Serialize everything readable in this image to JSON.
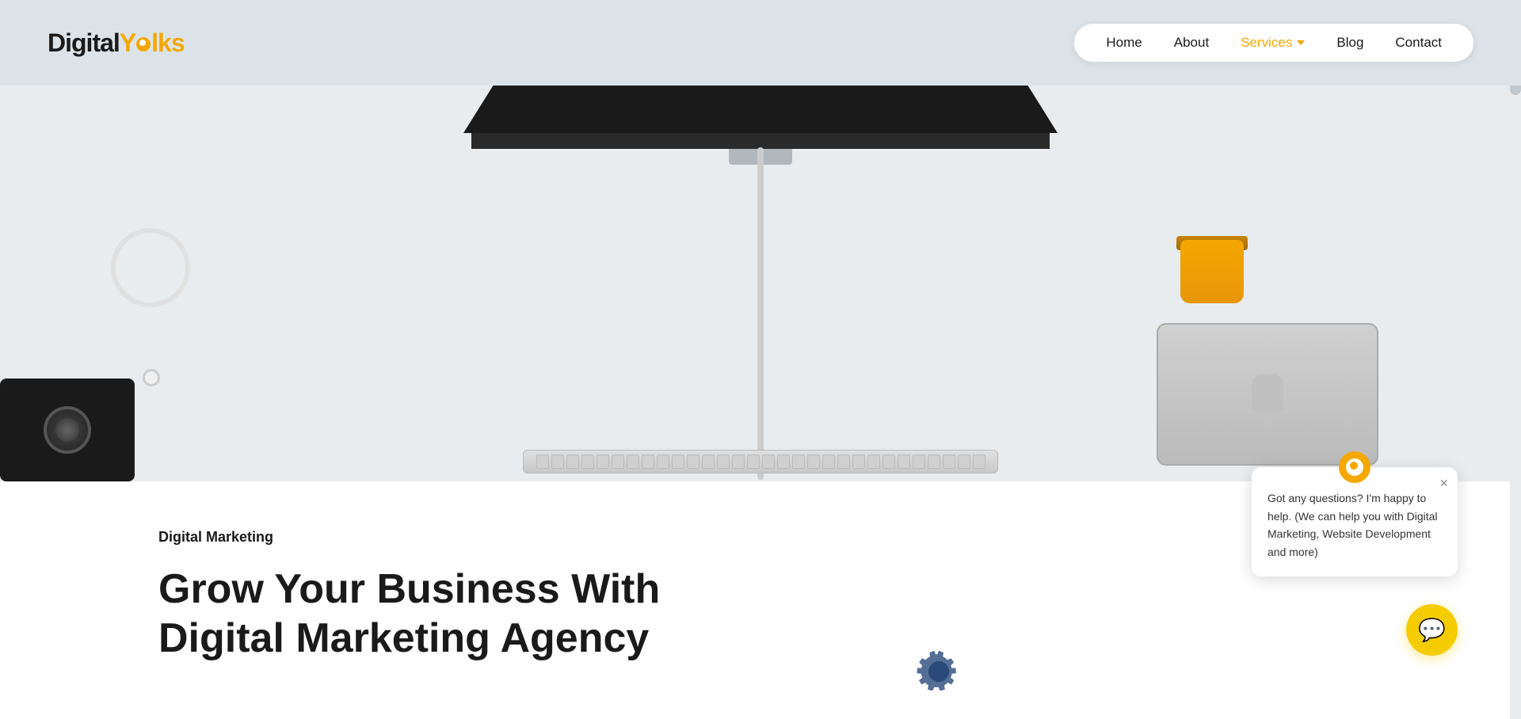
{
  "header": {
    "logo": {
      "digital": "Digital",
      "yolks": "Ylks",
      "y_char": "Y",
      "dot_char": "●"
    },
    "nav": {
      "home_label": "Home",
      "about_label": "About",
      "services_label": "Services",
      "blog_label": "Blog",
      "contact_label": "Contact"
    }
  },
  "hero": {
    "image_alt": "Desk setup with monitor, keyboard, camera, earphones"
  },
  "content": {
    "subtitle": "Digital Marketing",
    "title_line1": "Grow Your Business With",
    "title_line2": "Digital Marketing Agency"
  },
  "chat": {
    "avatar_alt": "Chat avatar",
    "message": "Got any questions? I'm happy to help. (We can help you with Digital Marketing, Website Development and more)",
    "close_label": "×",
    "button_icon": "💬"
  }
}
